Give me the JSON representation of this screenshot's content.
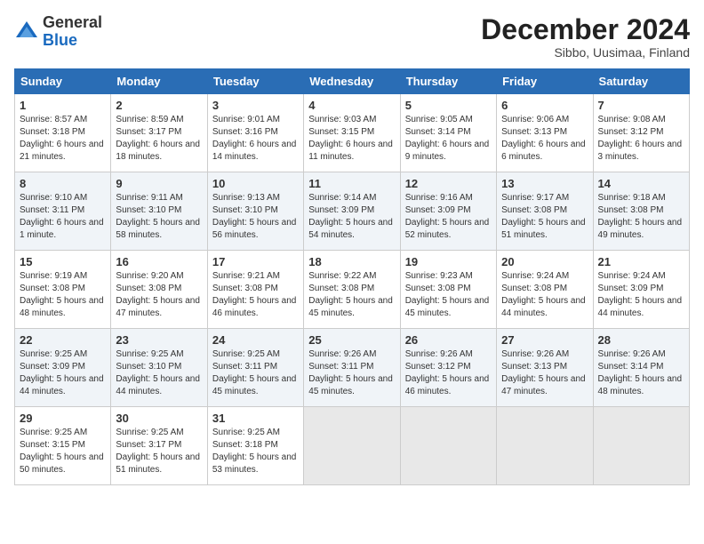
{
  "header": {
    "logo_general": "General",
    "logo_blue": "Blue",
    "month_title": "December 2024",
    "subtitle": "Sibbo, Uusimaa, Finland"
  },
  "calendar": {
    "days_of_week": [
      "Sunday",
      "Monday",
      "Tuesday",
      "Wednesday",
      "Thursday",
      "Friday",
      "Saturday"
    ],
    "weeks": [
      [
        {
          "day": "1",
          "sunrise": "Sunrise: 8:57 AM",
          "sunset": "Sunset: 3:18 PM",
          "daylight": "Daylight: 6 hours and 21 minutes."
        },
        {
          "day": "2",
          "sunrise": "Sunrise: 8:59 AM",
          "sunset": "Sunset: 3:17 PM",
          "daylight": "Daylight: 6 hours and 18 minutes."
        },
        {
          "day": "3",
          "sunrise": "Sunrise: 9:01 AM",
          "sunset": "Sunset: 3:16 PM",
          "daylight": "Daylight: 6 hours and 14 minutes."
        },
        {
          "day": "4",
          "sunrise": "Sunrise: 9:03 AM",
          "sunset": "Sunset: 3:15 PM",
          "daylight": "Daylight: 6 hours and 11 minutes."
        },
        {
          "day": "5",
          "sunrise": "Sunrise: 9:05 AM",
          "sunset": "Sunset: 3:14 PM",
          "daylight": "Daylight: 6 hours and 9 minutes."
        },
        {
          "day": "6",
          "sunrise": "Sunrise: 9:06 AM",
          "sunset": "Sunset: 3:13 PM",
          "daylight": "Daylight: 6 hours and 6 minutes."
        },
        {
          "day": "7",
          "sunrise": "Sunrise: 9:08 AM",
          "sunset": "Sunset: 3:12 PM",
          "daylight": "Daylight: 6 hours and 3 minutes."
        }
      ],
      [
        {
          "day": "8",
          "sunrise": "Sunrise: 9:10 AM",
          "sunset": "Sunset: 3:11 PM",
          "daylight": "Daylight: 6 hours and 1 minute."
        },
        {
          "day": "9",
          "sunrise": "Sunrise: 9:11 AM",
          "sunset": "Sunset: 3:10 PM",
          "daylight": "Daylight: 5 hours and 58 minutes."
        },
        {
          "day": "10",
          "sunrise": "Sunrise: 9:13 AM",
          "sunset": "Sunset: 3:10 PM",
          "daylight": "Daylight: 5 hours and 56 minutes."
        },
        {
          "day": "11",
          "sunrise": "Sunrise: 9:14 AM",
          "sunset": "Sunset: 3:09 PM",
          "daylight": "Daylight: 5 hours and 54 minutes."
        },
        {
          "day": "12",
          "sunrise": "Sunrise: 9:16 AM",
          "sunset": "Sunset: 3:09 PM",
          "daylight": "Daylight: 5 hours and 52 minutes."
        },
        {
          "day": "13",
          "sunrise": "Sunrise: 9:17 AM",
          "sunset": "Sunset: 3:08 PM",
          "daylight": "Daylight: 5 hours and 51 minutes."
        },
        {
          "day": "14",
          "sunrise": "Sunrise: 9:18 AM",
          "sunset": "Sunset: 3:08 PM",
          "daylight": "Daylight: 5 hours and 49 minutes."
        }
      ],
      [
        {
          "day": "15",
          "sunrise": "Sunrise: 9:19 AM",
          "sunset": "Sunset: 3:08 PM",
          "daylight": "Daylight: 5 hours and 48 minutes."
        },
        {
          "day": "16",
          "sunrise": "Sunrise: 9:20 AM",
          "sunset": "Sunset: 3:08 PM",
          "daylight": "Daylight: 5 hours and 47 minutes."
        },
        {
          "day": "17",
          "sunrise": "Sunrise: 9:21 AM",
          "sunset": "Sunset: 3:08 PM",
          "daylight": "Daylight: 5 hours and 46 minutes."
        },
        {
          "day": "18",
          "sunrise": "Sunrise: 9:22 AM",
          "sunset": "Sunset: 3:08 PM",
          "daylight": "Daylight: 5 hours and 45 minutes."
        },
        {
          "day": "19",
          "sunrise": "Sunrise: 9:23 AM",
          "sunset": "Sunset: 3:08 PM",
          "daylight": "Daylight: 5 hours and 45 minutes."
        },
        {
          "day": "20",
          "sunrise": "Sunrise: 9:24 AM",
          "sunset": "Sunset: 3:08 PM",
          "daylight": "Daylight: 5 hours and 44 minutes."
        },
        {
          "day": "21",
          "sunrise": "Sunrise: 9:24 AM",
          "sunset": "Sunset: 3:09 PM",
          "daylight": "Daylight: 5 hours and 44 minutes."
        }
      ],
      [
        {
          "day": "22",
          "sunrise": "Sunrise: 9:25 AM",
          "sunset": "Sunset: 3:09 PM",
          "daylight": "Daylight: 5 hours and 44 minutes."
        },
        {
          "day": "23",
          "sunrise": "Sunrise: 9:25 AM",
          "sunset": "Sunset: 3:10 PM",
          "daylight": "Daylight: 5 hours and 44 minutes."
        },
        {
          "day": "24",
          "sunrise": "Sunrise: 9:25 AM",
          "sunset": "Sunset: 3:11 PM",
          "daylight": "Daylight: 5 hours and 45 minutes."
        },
        {
          "day": "25",
          "sunrise": "Sunrise: 9:26 AM",
          "sunset": "Sunset: 3:11 PM",
          "daylight": "Daylight: 5 hours and 45 minutes."
        },
        {
          "day": "26",
          "sunrise": "Sunrise: 9:26 AM",
          "sunset": "Sunset: 3:12 PM",
          "daylight": "Daylight: 5 hours and 46 minutes."
        },
        {
          "day": "27",
          "sunrise": "Sunrise: 9:26 AM",
          "sunset": "Sunset: 3:13 PM",
          "daylight": "Daylight: 5 hours and 47 minutes."
        },
        {
          "day": "28",
          "sunrise": "Sunrise: 9:26 AM",
          "sunset": "Sunset: 3:14 PM",
          "daylight": "Daylight: 5 hours and 48 minutes."
        }
      ],
      [
        {
          "day": "29",
          "sunrise": "Sunrise: 9:25 AM",
          "sunset": "Sunset: 3:15 PM",
          "daylight": "Daylight: 5 hours and 50 minutes."
        },
        {
          "day": "30",
          "sunrise": "Sunrise: 9:25 AM",
          "sunset": "Sunset: 3:17 PM",
          "daylight": "Daylight: 5 hours and 51 minutes."
        },
        {
          "day": "31",
          "sunrise": "Sunrise: 9:25 AM",
          "sunset": "Sunset: 3:18 PM",
          "daylight": "Daylight: 5 hours and 53 minutes."
        },
        null,
        null,
        null,
        null
      ]
    ]
  }
}
